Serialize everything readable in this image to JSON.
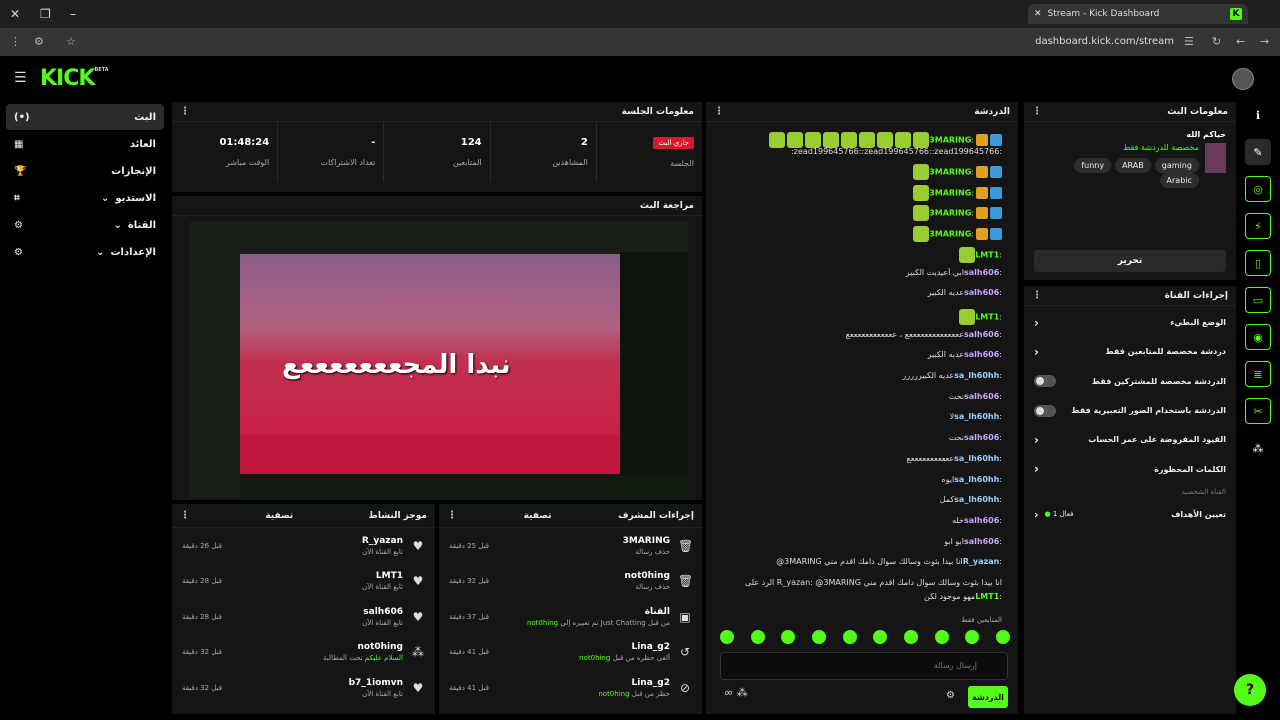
{
  "browser": {
    "tab_title": "Stream - Kick Dashboard",
    "url": "dashboard.kick.com/stream"
  },
  "header": {
    "logo": "KICK",
    "logo_tag": "BETA"
  },
  "nav": [
    {
      "label": "البث",
      "icon": "(•)"
    },
    {
      "label": "العائد",
      "icon": "▦"
    },
    {
      "label": "الإنجازات",
      "icon": "🏆"
    },
    {
      "label": "الاستديو",
      "icon": "⌗"
    },
    {
      "label": "القناة",
      "icon": "⚙"
    },
    {
      "label": "الإعدادات",
      "icon": "⚙"
    }
  ],
  "session": {
    "title": "معلومات الجلسة",
    "stats": [
      {
        "value": "01:48:24",
        "label": "الوقت مباشر"
      },
      {
        "value": "-",
        "label": "تعداد الاشتراكات"
      },
      {
        "value": "124",
        "label": "المتابعين"
      },
      {
        "value": "2",
        "label": "المشاهدين"
      },
      {
        "value": "",
        "label": "الجلسة",
        "badge": "جاري البث"
      }
    ]
  },
  "preview": {
    "title": "مراجعة البث",
    "overlay_text": "نبدا المجعععععععع"
  },
  "activity": {
    "title": "موجز النشاط",
    "filter": "تصفية",
    "items": [
      {
        "name": "R_yazan",
        "desc": "تابع القناة الآن",
        "time": "قبل 26 دقيقة"
      },
      {
        "name": "LMT1",
        "desc": "تابع القناة الآن",
        "time": "قبل 28 دقيقة"
      },
      {
        "name": "salh606",
        "desc": "تابع القناة الآن",
        "time": "قبل 28 دقيقة"
      },
      {
        "name": "not0hing",
        "desc": "تحت المطالبة",
        "desc_hl": "السلام عليكم",
        "time": "قبل 32 دقيقة"
      },
      {
        "name": "b7_1iomvn",
        "desc": "تابع القناة الآن",
        "time": "قبل 32 دقيقة"
      }
    ]
  },
  "modactions": {
    "title": "إجراءات المشرف",
    "filter": "تصفية",
    "items": [
      {
        "name": "3MARING",
        "desc": "حذف رسالة",
        "time": "قبل 25 دقيقة"
      },
      {
        "name": "not0hing",
        "desc": "حذف رسالة",
        "time": "قبل 32 دقيقة"
      },
      {
        "name": "القناة",
        "desc": "تم تغييره إلى Just Chatting من قبل",
        "desc_hl": "not0hing",
        "time": "قبل 37 دقيقة"
      },
      {
        "name": "Lina_g2",
        "desc": "ألغى حظره من قبل",
        "desc_hl": "not0hing",
        "time": "قبل 41 دقيقة"
      },
      {
        "name": "Lina_g2",
        "desc": "حظر من قبل",
        "desc_hl": "not0hing",
        "time": "قبل 41 دقيقة"
      }
    ]
  },
  "chat": {
    "title": "الدردشة",
    "placeholder": "إرسال رسالة",
    "send": "الدردشة",
    "followers_label": "المتابعين فقط",
    "messages": [
      {
        "user": "3MARING",
        "text": "",
        "cls": "u-g",
        "emotes": 9
      },
      {
        "user": "",
        "text": ":zead199645766::zead199645766::zead199645766:",
        "cls": "u-w",
        "emotes": 0
      },
      {
        "user": "3MARING",
        "text": "",
        "cls": "u-g",
        "emotes": 1
      },
      {
        "user": "3MARING",
        "text": "",
        "cls": "u-g",
        "emotes": 1
      },
      {
        "user": "3MARING",
        "text": "",
        "cls": "u-g",
        "emotes": 1
      },
      {
        "user": "3MARING",
        "text": "",
        "cls": "u-g",
        "emotes": 1
      },
      {
        "user": "LMT1",
        "text": "",
        "cls": "u-g",
        "emotes": 1
      },
      {
        "user": "salh606",
        "text": "ابي أعيديت الكبير",
        "cls": "u-p",
        "emotes": 0
      },
      {
        "user": "salh606",
        "text": "عديه الكبير",
        "cls": "u-p",
        "emotes": 0
      },
      {
        "user": "LMT1",
        "text": "",
        "cls": "u-g",
        "emotes": 1
      },
      {
        "user": "salh606",
        "text": "ععععععععععععععع ، ععععععععععععع",
        "cls": "u-p",
        "emotes": 0
      },
      {
        "user": "salh606",
        "text": "عديه الكبير",
        "cls": "u-p",
        "emotes": 0
      },
      {
        "user": "sa_lh60hh",
        "text": "عديه الكبيررررر",
        "cls": "u-b",
        "emotes": 0
      },
      {
        "user": "salh606",
        "text": "نحت",
        "cls": "u-p",
        "emotes": 0
      },
      {
        "user": "sa_lh60hh",
        "text": "لا",
        "cls": "u-b",
        "emotes": 0
      },
      {
        "user": "salh606",
        "text": "نحت",
        "cls": "u-p",
        "emotes": 0
      },
      {
        "user": "sa_lh60hh",
        "text": "عععععععععععع",
        "cls": "u-b",
        "emotes": 0
      },
      {
        "user": "sa_lh60hh",
        "text": "ايوه",
        "cls": "u-b",
        "emotes": 0
      },
      {
        "user": "sa_lh60hh",
        "text": "كمل",
        "cls": "u-b",
        "emotes": 0
      },
      {
        "user": "salh606",
        "text": "خله",
        "cls": "u-p",
        "emotes": 0
      },
      {
        "user": "salh606",
        "text": "ابو ابو",
        "cls": "u-p",
        "emotes": 0
      },
      {
        "user": "R_yazan",
        "text": "@3MARING انا بيدا بثوث وسالك سوال دامك اقدم مني",
        "cls": "u-b",
        "emotes": 0
      },
      {
        "user": "",
        "text": "الرد على R_yazan: @3MARING انا بيدا بثوث وسالك سوال دامك اقدم مني",
        "cls": "u-w",
        "emotes": 0
      },
      {
        "user": "LMT1",
        "text": "مهو موجود لكن",
        "cls": "u-g",
        "emotes": 0
      }
    ]
  },
  "stream_info": {
    "title": "معلومات البث",
    "stream_title": "حياكم الله",
    "category": "مخصصة للدردشة فقط",
    "tags": [
      "funny",
      "ARAB",
      "gaming",
      "Arabic"
    ],
    "edit": "تحرير"
  },
  "channel_actions": {
    "title": "إجراءات القناة",
    "items": [
      {
        "label": "الوضع البطيء",
        "kind": "arrow"
      },
      {
        "label": "دردشة مخصصة للمتابعين فقط",
        "kind": "arrow"
      },
      {
        "label": "الدردشة مخصصة للمشتركين فقط",
        "kind": "toggle"
      },
      {
        "label": "الدردشة باستخدام الصور التعبيرية فقط",
        "kind": "toggle"
      },
      {
        "label": "القيود المفروضة على عمر الحساب",
        "kind": "arrow"
      },
      {
        "label": "الكلمات المحظورة",
        "kind": "arrow"
      }
    ],
    "section": "القناة الشخصية",
    "goal": "تعيين الأهداف",
    "goal_val": "فعال 1"
  }
}
